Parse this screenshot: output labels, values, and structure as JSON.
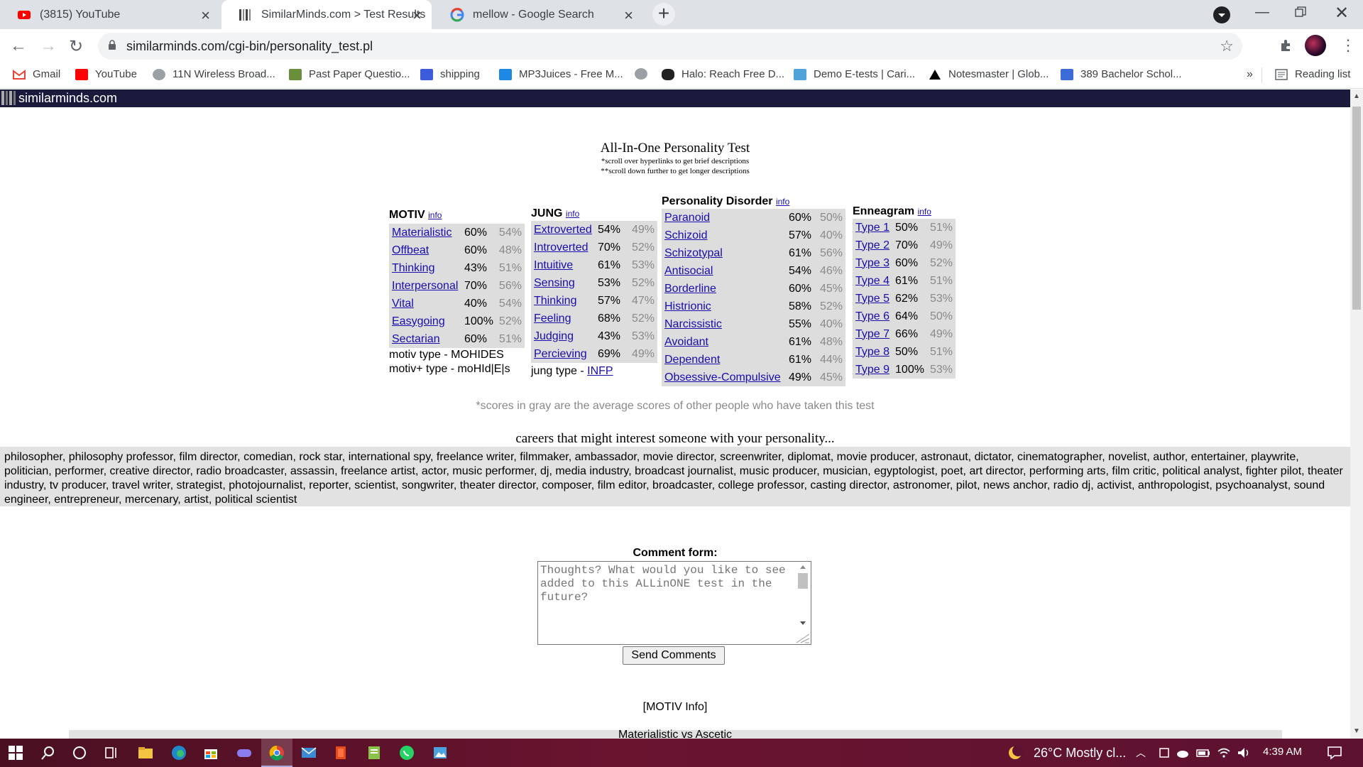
{
  "browser": {
    "tabs": [
      {
        "title": "(3815) YouTube",
        "icon": "youtube-icon",
        "active": false
      },
      {
        "title": "SimilarMinds.com > Test Results",
        "icon": "similarminds-icon",
        "active": true
      },
      {
        "title": "mellow - Google Search",
        "icon": "google-icon",
        "active": false
      }
    ],
    "url": "similarminds.com/cgi-bin/personality_test.pl",
    "bookmarks": [
      {
        "label": "Gmail",
        "icon": "gmail-icon"
      },
      {
        "label": "YouTube",
        "icon": "youtube-icon"
      },
      {
        "label": "11N Wireless Broad...",
        "icon": "globe-icon"
      },
      {
        "label": "Past Paper Questio...",
        "icon": "paper-icon"
      },
      {
        "label": "shipping",
        "icon": "shipping-icon"
      },
      {
        "label": "MP3Juices - Free M...",
        "icon": "download-icon"
      },
      {
        "label": "",
        "icon": "globe-icon"
      },
      {
        "label": "Halo: Reach Free D...",
        "icon": "halo-icon"
      },
      {
        "label": "Demo E-tests | Cari...",
        "icon": "etest-icon"
      },
      {
        "label": "Notesmaster | Glob...",
        "icon": "triangle-icon"
      },
      {
        "label": "389 Bachelor Schol...",
        "icon": "building-icon"
      }
    ],
    "more_bookmarks": "»",
    "reading_list": "Reading list"
  },
  "site": {
    "name": "similarminds.com",
    "title": "All-In-One Personality Test",
    "note1": "*scroll over hyperlinks to get brief descriptions",
    "note2": "**scroll down further to get longer descriptions",
    "info_link": "info"
  },
  "motiv": {
    "heading": "MOTIV",
    "rows": [
      {
        "name": "Materialistic",
        "score": "60%",
        "avg": "54%"
      },
      {
        "name": "Offbeat",
        "score": "60%",
        "avg": "48%"
      },
      {
        "name": "Thinking",
        "score": "43%",
        "avg": "51%"
      },
      {
        "name": "Interpersonal",
        "score": "70%",
        "avg": "56%"
      },
      {
        "name": "Vital",
        "score": "40%",
        "avg": "54%"
      },
      {
        "name": "Easygoing",
        "score": "100%",
        "avg": "52%"
      },
      {
        "name": "Sectarian",
        "score": "60%",
        "avg": "51%"
      }
    ],
    "type_line": "motiv type - MOHIDES",
    "plus_line": "motiv+ type - moHId|E|s"
  },
  "jung": {
    "heading": "JUNG",
    "rows": [
      {
        "name": "Extroverted",
        "score": "54%",
        "avg": "49%"
      },
      {
        "name": "Introverted",
        "score": "70%",
        "avg": "52%"
      },
      {
        "name": "Intuitive",
        "score": "61%",
        "avg": "53%"
      },
      {
        "name": "Sensing",
        "score": "53%",
        "avg": "52%"
      },
      {
        "name": "Thinking",
        "score": "57%",
        "avg": "47%"
      },
      {
        "name": "Feeling",
        "score": "68%",
        "avg": "52%"
      },
      {
        "name": "Judging",
        "score": "43%",
        "avg": "53%"
      },
      {
        "name": "Percieving",
        "score": "69%",
        "avg": "49%"
      }
    ],
    "type_label": "jung type - ",
    "type_value": "INFP"
  },
  "disorder": {
    "heading": "Personality Disorder",
    "rows": [
      {
        "name": "Paranoid",
        "score": "60%",
        "avg": "50%"
      },
      {
        "name": "Schizoid",
        "score": "57%",
        "avg": "40%"
      },
      {
        "name": "Schizotypal",
        "score": "61%",
        "avg": "56%"
      },
      {
        "name": "Antisocial",
        "score": "54%",
        "avg": "46%"
      },
      {
        "name": "Borderline",
        "score": "60%",
        "avg": "45%"
      },
      {
        "name": "Histrionic",
        "score": "58%",
        "avg": "52%"
      },
      {
        "name": "Narcissistic",
        "score": "55%",
        "avg": "40%"
      },
      {
        "name": "Avoidant",
        "score": "61%",
        "avg": "48%"
      },
      {
        "name": "Dependent",
        "score": "61%",
        "avg": "44%"
      },
      {
        "name": "Obsessive-Compulsive",
        "score": "49%",
        "avg": "45%"
      }
    ]
  },
  "enneagram": {
    "heading": "Enneagram",
    "rows": [
      {
        "name": "Type 1",
        "score": "50%",
        "avg": "51%"
      },
      {
        "name": "Type 2",
        "score": "70%",
        "avg": "49%"
      },
      {
        "name": "Type 3",
        "score": "60%",
        "avg": "52%"
      },
      {
        "name": "Type 4",
        "score": "61%",
        "avg": "51%"
      },
      {
        "name": "Type 5",
        "score": "62%",
        "avg": "53%"
      },
      {
        "name": "Type 6",
        "score": "64%",
        "avg": "50%"
      },
      {
        "name": "Type 7",
        "score": "66%",
        "avg": "49%"
      },
      {
        "name": "Type 8",
        "score": "50%",
        "avg": "51%"
      },
      {
        "name": "Type 9",
        "score": "100%",
        "avg": "53%"
      }
    ]
  },
  "gray_note": "*scores in gray are the average scores of other people who have taken this test",
  "careers": {
    "title": "careers that might interest someone with your personality...",
    "text": "philosopher, philosophy professor, film director, comedian, rock star, international spy, freelance writer, filmmaker, ambassador, movie director, screenwriter, diplomat, movie producer, astronaut, dictator, cinematographer, novelist, author, entertainer, playwrite, politician, performer, creative director, radio broadcaster, assassin, freelance artist, actor, music performer, dj, media industry, broadcast journalist, music producer, musician, egyptologist, poet, art director, performing arts, film critic, political analyst, fighter pilot, theater industry, tv producer, travel writer, strategist, photojournalist, reporter, scientist, songwriter, theater director, composer, film editor, broadcaster, college professor, casting director, astronomer, pilot, news anchor, radio dj, activist, anthropologist, psychoanalyst, sound engineer, entrepreneur, mercenary, artist, political scientist"
  },
  "comment": {
    "label": "Comment form:",
    "placeholder": "Thoughts? What would you like to see added to this ALLinONE test in the future?",
    "button": "Send Comments"
  },
  "motiv_info": "[MOTIV Info]",
  "motiv_first_section": "Materialistic vs Ascetic",
  "taskbar": {
    "weather": "26°C  Mostly cl...",
    "time": "4:39 AM"
  },
  "colors": {
    "header_bg": "#1a1a3d",
    "link": "#1a0dab",
    "table_bg": "#dddddd",
    "avg_gray": "#8a8a8a"
  }
}
